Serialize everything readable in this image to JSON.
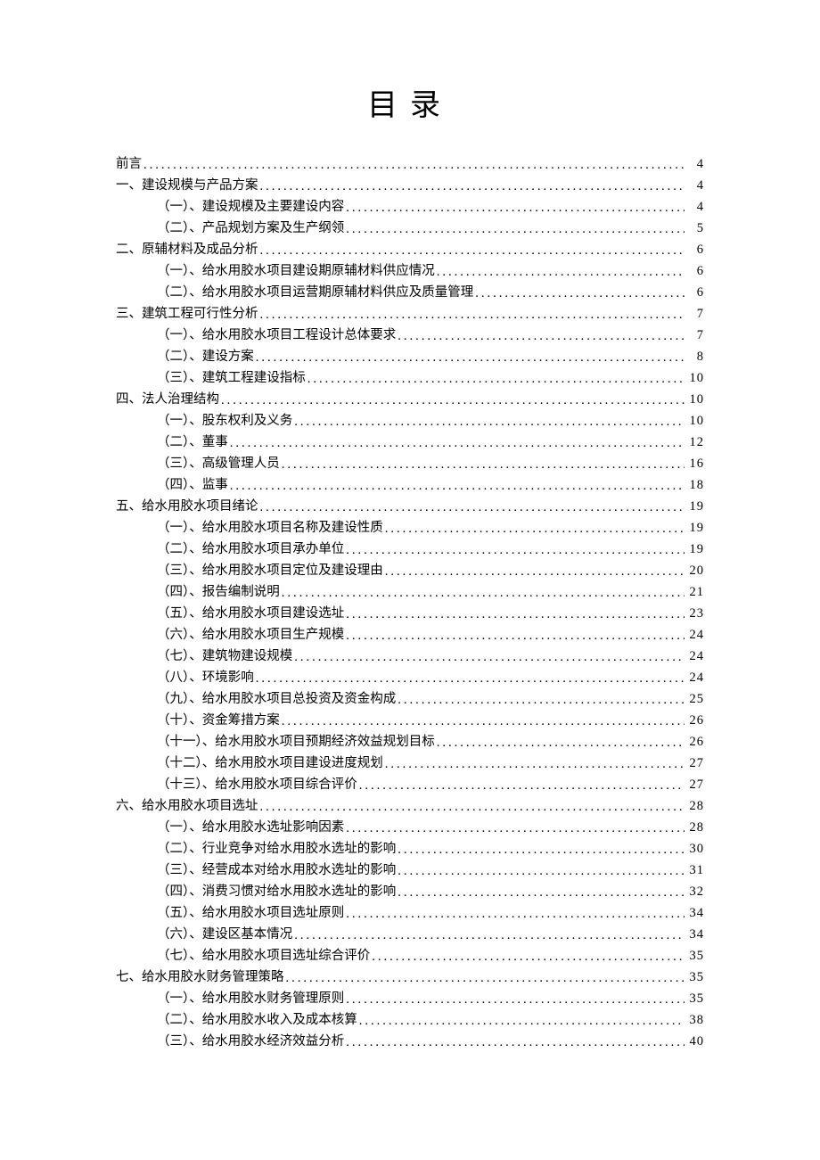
{
  "title": "目录",
  "entries": [
    {
      "level": 0,
      "label": "前言",
      "page": "4"
    },
    {
      "level": 0,
      "label": "一、建设规模与产品方案",
      "page": "4"
    },
    {
      "level": 1,
      "label": "（一）、建设规模及主要建设内容",
      "page": "4"
    },
    {
      "level": 1,
      "label": "（二）、产品规划方案及生产纲领",
      "page": "5"
    },
    {
      "level": 0,
      "label": "二、原辅材料及成品分析",
      "page": "6"
    },
    {
      "level": 1,
      "label": "（一）、给水用胶水项目建设期原辅材料供应情况",
      "page": "6"
    },
    {
      "level": 1,
      "label": "（二）、给水用胶水项目运营期原辅材料供应及质量管理",
      "page": "6"
    },
    {
      "level": 0,
      "label": "三、建筑工程可行性分析",
      "page": "7"
    },
    {
      "level": 1,
      "label": "（一）、给水用胶水项目工程设计总体要求",
      "page": "7"
    },
    {
      "level": 1,
      "label": "（二）、建设方案",
      "page": "8"
    },
    {
      "level": 1,
      "label": "（三）、建筑工程建设指标",
      "page": "10"
    },
    {
      "level": 0,
      "label": "四、法人治理结构",
      "page": "10"
    },
    {
      "level": 1,
      "label": "（一）、股东权利及义务",
      "page": "10"
    },
    {
      "level": 1,
      "label": "（二）、董事",
      "page": "12"
    },
    {
      "level": 1,
      "label": "（三）、高级管理人员",
      "page": "16"
    },
    {
      "level": 1,
      "label": "（四）、监事",
      "page": "18"
    },
    {
      "level": 0,
      "label": "五、给水用胶水项目绪论",
      "page": "19"
    },
    {
      "level": 1,
      "label": "（一）、给水用胶水项目名称及建设性质",
      "page": "19"
    },
    {
      "level": 1,
      "label": "（二）、给水用胶水项目承办单位",
      "page": "19"
    },
    {
      "level": 1,
      "label": "（三）、给水用胶水项目定位及建设理由",
      "page": "20"
    },
    {
      "level": 1,
      "label": "（四）、报告编制说明",
      "page": "21"
    },
    {
      "level": 1,
      "label": "（五）、给水用胶水项目建设选址",
      "page": "23"
    },
    {
      "level": 1,
      "label": "（六）、给水用胶水项目生产规模",
      "page": "24"
    },
    {
      "level": 1,
      "label": "（七）、建筑物建设规模",
      "page": "24"
    },
    {
      "level": 1,
      "label": "（八）、环境影响",
      "page": "24"
    },
    {
      "level": 1,
      "label": "（九）、给水用胶水项目总投资及资金构成",
      "page": "25"
    },
    {
      "level": 1,
      "label": "（十）、资金筹措方案",
      "page": "26"
    },
    {
      "level": 1,
      "label": "（十一）、给水用胶水项目预期经济效益规划目标",
      "page": "26"
    },
    {
      "level": 1,
      "label": "（十二）、给水用胶水项目建设进度规划",
      "page": "27"
    },
    {
      "level": 1,
      "label": "（十三）、给水用胶水项目综合评价",
      "page": "27"
    },
    {
      "level": 0,
      "label": "六、给水用胶水项目选址",
      "page": "28"
    },
    {
      "level": 1,
      "label": "（一）、给水用胶水选址影响因素",
      "page": "28"
    },
    {
      "level": 1,
      "label": "（二）、行业竞争对给水用胶水选址的影响",
      "page": "30"
    },
    {
      "level": 1,
      "label": "（三）、经营成本对给水用胶水选址的影响",
      "page": "31"
    },
    {
      "level": 1,
      "label": "（四）、消费习惯对给水用胶水选址的影响",
      "page": "32"
    },
    {
      "level": 1,
      "label": "（五）、给水用胶水项目选址原则",
      "page": "34"
    },
    {
      "level": 1,
      "label": "（六）、建设区基本情况",
      "page": "34"
    },
    {
      "level": 1,
      "label": "（七）、给水用胶水项目选址综合评价",
      "page": "35"
    },
    {
      "level": 0,
      "label": "七、给水用胶水财务管理策略",
      "page": "35"
    },
    {
      "level": 1,
      "label": "（一）、给水用胶水财务管理原则",
      "page": "35"
    },
    {
      "level": 1,
      "label": "（二）、给水用胶水收入及成本核算",
      "page": "38"
    },
    {
      "level": 1,
      "label": "（三）、给水用胶水经济效益分析",
      "page": "40"
    }
  ]
}
